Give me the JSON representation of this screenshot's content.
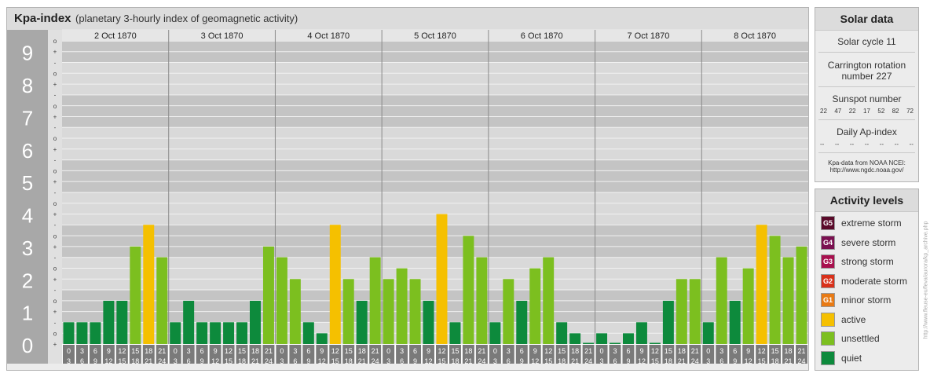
{
  "header": {
    "title": "Kpa-index",
    "subtitle": "(planetary 3-hourly index of geomagnetic activity)"
  },
  "chart_data": {
    "type": "bar",
    "title": "Kpa-index",
    "subtitle": "(planetary 3-hourly index of geomagnetic activity)",
    "ylim": [
      0,
      9.67
    ],
    "y_ticks": [
      "0",
      "1",
      "2",
      "3",
      "4",
      "5",
      "6",
      "7",
      "8",
      "9"
    ],
    "y_minor_ticks": [
      "-",
      "+",
      "o"
    ],
    "days": [
      "2 Oct 1870",
      "3 Oct 1870",
      "4 Oct 1870",
      "5 Oct 1870",
      "6 Oct 1870",
      "7 Oct 1870",
      "8 Oct 1870"
    ],
    "interval_starts": [
      "0",
      "3",
      "6",
      "9",
      "12",
      "15",
      "18",
      "21"
    ],
    "interval_ends": [
      "3",
      "6",
      "9",
      "12",
      "15",
      "18",
      "21",
      "24"
    ],
    "values": [
      [
        0.67,
        0.67,
        0.67,
        1.33,
        1.33,
        3.0,
        3.67,
        2.67
      ],
      [
        0.67,
        1.33,
        0.67,
        0.67,
        0.67,
        0.67,
        1.33,
        3.0
      ],
      [
        2.67,
        2.0,
        0.67,
        0.33,
        3.67,
        2.0,
        1.33,
        2.67
      ],
      [
        2.0,
        2.33,
        2.0,
        1.33,
        4.0,
        0.67,
        3.33,
        2.67
      ],
      [
        0.67,
        2.0,
        1.33,
        2.33,
        2.67,
        0.67,
        0.33,
        0.0
      ],
      [
        0.33,
        0.0,
        0.33,
        0.67,
        0.0,
        1.33,
        2.0,
        2.0
      ],
      [
        0.67,
        2.67,
        1.33,
        2.33,
        3.67,
        3.33,
        2.67,
        3.0
      ]
    ],
    "color_rule": "quiet below 2-, unsettled 2- to 4-, active 4- to 5-",
    "colors": {
      "quiet": "#0d8a3c",
      "unsettled": "#7cbf1f",
      "active": "#f5c000",
      "band_dark": "#c4c4c4",
      "band_light": "#d9d9d9",
      "axis_bg": "#a8a8a8"
    }
  },
  "solar": {
    "title": "Solar data",
    "cycle": "Solar cycle 11",
    "carrington_line1": "Carrington rotation",
    "carrington_line2": "number 227",
    "sunspot_label": "Sunspot number",
    "sunspots": [
      "22",
      "47",
      "22",
      "17",
      "52",
      "82",
      "72"
    ],
    "ap_label": "Daily Ap-index",
    "ap_values": [
      "--",
      "--",
      "--",
      "--",
      "--",
      "--",
      "--"
    ],
    "source_line1": "Kpa-data from NOAA NCEI:",
    "source_line2": "http://www.ngdc.noaa.gov/"
  },
  "activity": {
    "title": "Activity levels",
    "items": [
      {
        "code": "G5",
        "label": "extreme storm",
        "color": "#5a0a2a"
      },
      {
        "code": "G4",
        "label": "severe storm",
        "color": "#7a1050"
      },
      {
        "code": "G3",
        "label": "strong storm",
        "color": "#a8104e"
      },
      {
        "code": "G2",
        "label": "moderate storm",
        "color": "#d9301a"
      },
      {
        "code": "G1",
        "label": "minor storm",
        "color": "#e87a14"
      },
      {
        "code": "",
        "label": "active",
        "color": "#f5c000"
      },
      {
        "code": "",
        "label": "unsettled",
        "color": "#7cbf1f"
      },
      {
        "code": "",
        "label": "quiet",
        "color": "#0d8a3c"
      }
    ]
  },
  "watermark": "http://www.fleuse-eu/feva/aurora/kp_archive.php"
}
